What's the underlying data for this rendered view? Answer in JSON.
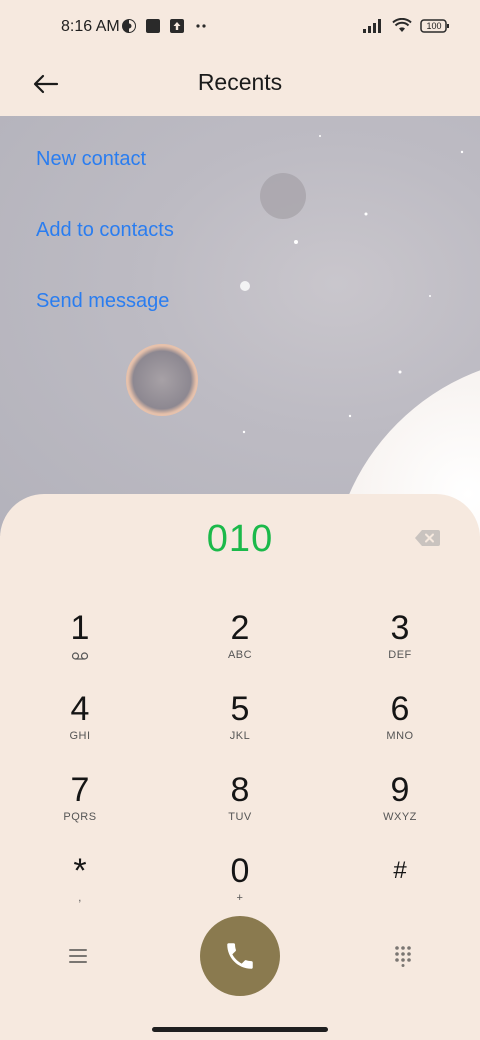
{
  "status_bar": {
    "time": "8:16 AM",
    "battery": "100",
    "left_icons": [
      "vpn-icon",
      "app-square-icon",
      "upload-icon",
      "more-dots-icon"
    ],
    "right_icons": [
      "signal-icon",
      "wifi-icon",
      "battery-icon"
    ]
  },
  "header": {
    "title": "Recents",
    "back_icon": "back-arrow-icon"
  },
  "actions": {
    "new_contact": "New contact",
    "add_to_contacts": "Add to contacts",
    "send_message": "Send message"
  },
  "dialer": {
    "number": "010",
    "keys": [
      {
        "digit": "1",
        "letters": ""
      },
      {
        "digit": "2",
        "letters": "ABC"
      },
      {
        "digit": "3",
        "letters": "DEF"
      },
      {
        "digit": "4",
        "letters": "GHI"
      },
      {
        "digit": "5",
        "letters": "JKL"
      },
      {
        "digit": "6",
        "letters": "MNO"
      },
      {
        "digit": "7",
        "letters": "PQRS"
      },
      {
        "digit": "8",
        "letters": "TUV"
      },
      {
        "digit": "9",
        "letters": "WXYZ"
      },
      {
        "digit": "*",
        "letters": ","
      },
      {
        "digit": "0",
        "letters": "+"
      },
      {
        "digit": "#",
        "letters": ""
      }
    ]
  },
  "colors": {
    "accent_link": "#2a7df0",
    "number_green": "#1bb94a",
    "call_button": "#8a7a4f",
    "sheet_background": "#f6e9df"
  }
}
